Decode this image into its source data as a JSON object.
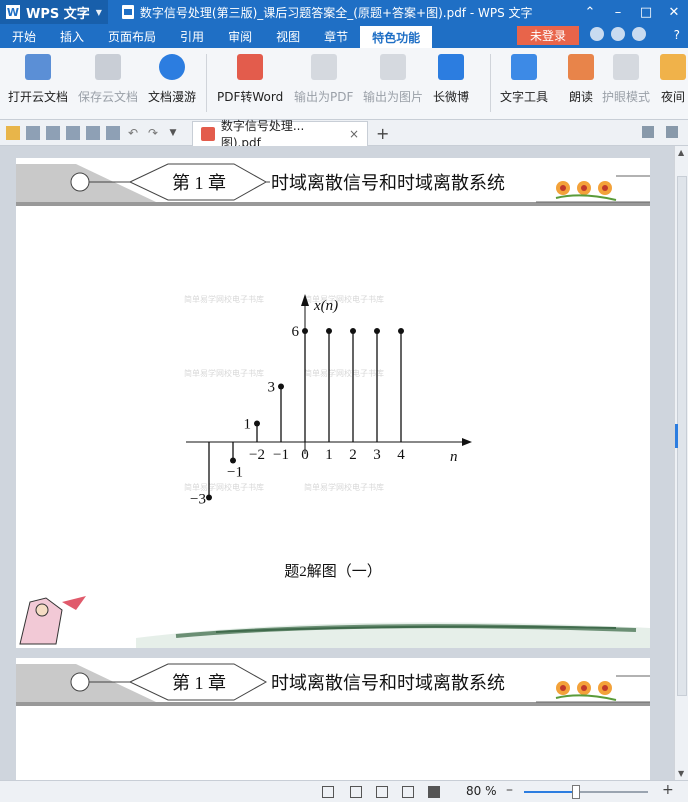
{
  "app": {
    "name": "WPS 文字",
    "logo_letter": "W"
  },
  "window": {
    "title": "数字信号处理(第三版)_课后习题答案全_(原题+答案+图).pdf - WPS 文字"
  },
  "menu": {
    "items": [
      "开始",
      "插入",
      "页面布局",
      "引用",
      "审阅",
      "视图",
      "章节",
      "特色功能"
    ],
    "active": "特色功能",
    "login": "未登录"
  },
  "ribbon": {
    "buttons": [
      {
        "label": "打开云文档",
        "enabled": true
      },
      {
        "label": "保存云文档",
        "enabled": false
      },
      {
        "label": "文档漫游",
        "enabled": true
      },
      {
        "label": "PDF转Word",
        "enabled": true
      },
      {
        "label": "输出为PDF",
        "enabled": false
      },
      {
        "label": "输出为图片",
        "enabled": false
      },
      {
        "label": "长微博",
        "enabled": true
      },
      {
        "label": "文字工具",
        "enabled": true
      },
      {
        "label": "朗读",
        "enabled": true
      },
      {
        "label": "护眼模式",
        "enabled": false
      },
      {
        "label": "夜间",
        "enabled": true
      }
    ]
  },
  "tab": {
    "label": "数字信号处理...图).pdf"
  },
  "page": {
    "chapter_label": "第 1 章",
    "chapter_title": "时域离散信号和时域离散系统",
    "figure_caption": "题2解图（一）"
  },
  "figure": {
    "y_label": "x(n)",
    "x_label": "n",
    "samples": [
      {
        "n": -4,
        "value": -3,
        "label": "−3"
      },
      {
        "n": -3,
        "value": -1,
        "label": "−1"
      },
      {
        "n": -2,
        "value": 1,
        "label": "1"
      },
      {
        "n": -1,
        "value": 3,
        "label": "3"
      },
      {
        "n": 0,
        "value": 6,
        "label": "6"
      },
      {
        "n": 1,
        "value": 6,
        "label": ""
      },
      {
        "n": 2,
        "value": 6,
        "label": ""
      },
      {
        "n": 3,
        "value": 6,
        "label": ""
      },
      {
        "n": 4,
        "value": 6,
        "label": ""
      }
    ],
    "x_ticks": [
      "−2",
      "−1",
      "0",
      "1",
      "2",
      "3",
      "4"
    ],
    "watermark": "简单易学网校电子书库"
  },
  "status": {
    "zoom": "80 %"
  },
  "colors": {
    "accent": "#1f6fc5",
    "login": "#e8644a",
    "slider": "#2c7de0"
  }
}
